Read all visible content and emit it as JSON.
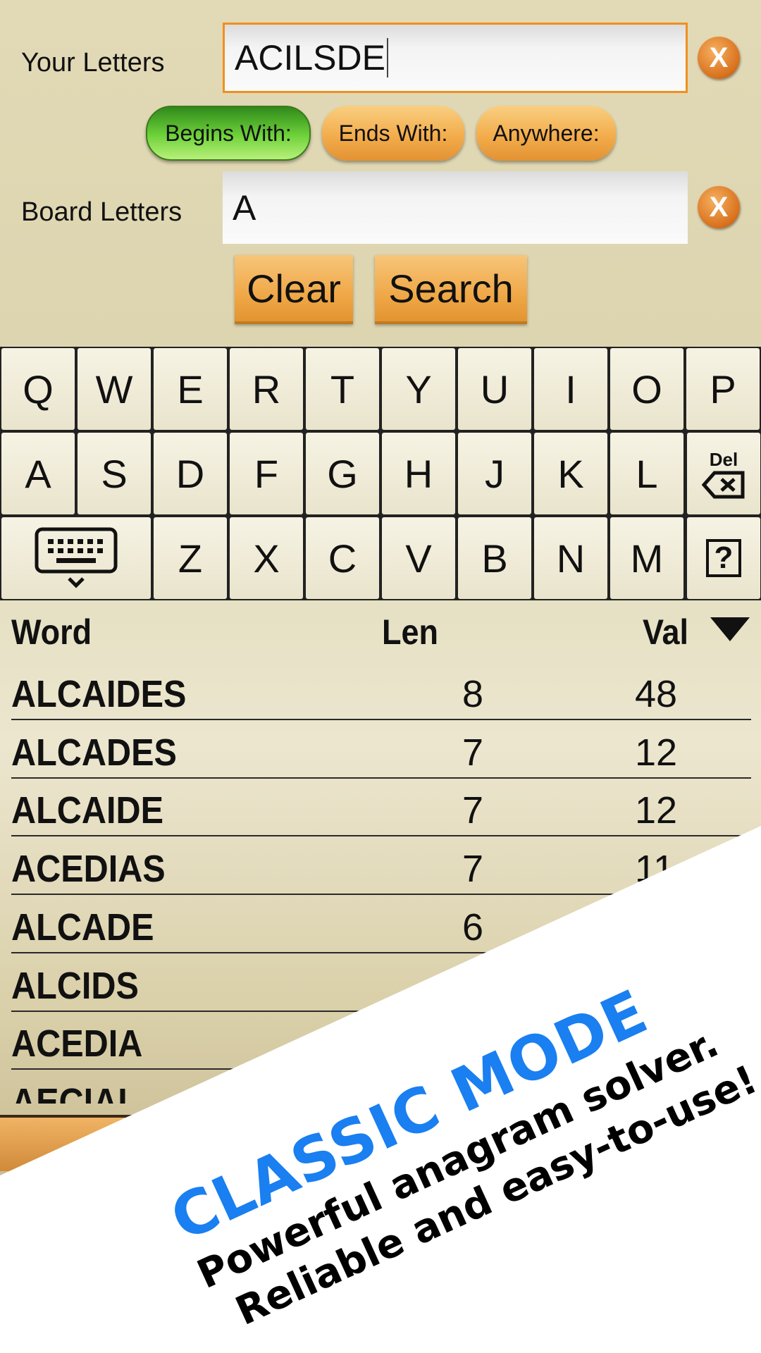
{
  "search": {
    "your_letters_label": "Your Letters",
    "your_letters_value": "ACILSDE",
    "board_letters_label": "Board Letters",
    "board_letters_value": "A",
    "clear_icon": "X",
    "modes": [
      {
        "label": "Begins With:",
        "active": true
      },
      {
        "label": "Ends With:",
        "active": false
      },
      {
        "label": "Anywhere:",
        "active": false
      }
    ],
    "clear_label": "Clear",
    "search_label": "Search"
  },
  "keyboard": {
    "row1": [
      "Q",
      "W",
      "E",
      "R",
      "T",
      "Y",
      "U",
      "I",
      "O",
      "P"
    ],
    "row2": [
      "A",
      "S",
      "D",
      "F",
      "G",
      "H",
      "J",
      "K",
      "L"
    ],
    "row3": [
      "Z",
      "X",
      "C",
      "V",
      "B",
      "N",
      "M"
    ],
    "del_label": "Del",
    "help_label": "?"
  },
  "results": {
    "headers": {
      "word": "Word",
      "len": "Len",
      "val": "Val"
    },
    "sort": "val-descending",
    "rows": [
      {
        "word": "ALCAIDES",
        "len": "8",
        "val": "48"
      },
      {
        "word": "ALCADES",
        "len": "7",
        "val": "12"
      },
      {
        "word": "ALCAIDE",
        "len": "7",
        "val": "12"
      },
      {
        "word": "ACEDIAS",
        "len": "7",
        "val": "11"
      },
      {
        "word": "ALCADE",
        "len": "6",
        "val": ""
      },
      {
        "word": "ALCIDS",
        "len": "",
        "val": ""
      },
      {
        "word": "ACEDIA",
        "len": "",
        "val": ""
      },
      {
        "word": "AECIAL",
        "len": "",
        "val": ""
      }
    ]
  },
  "promo": {
    "title": "CLASSIC MODE",
    "line1": "Powerful anagram solver.",
    "line2": "Reliable and easy-to-use!",
    "title_color": "#1a7ff0"
  }
}
